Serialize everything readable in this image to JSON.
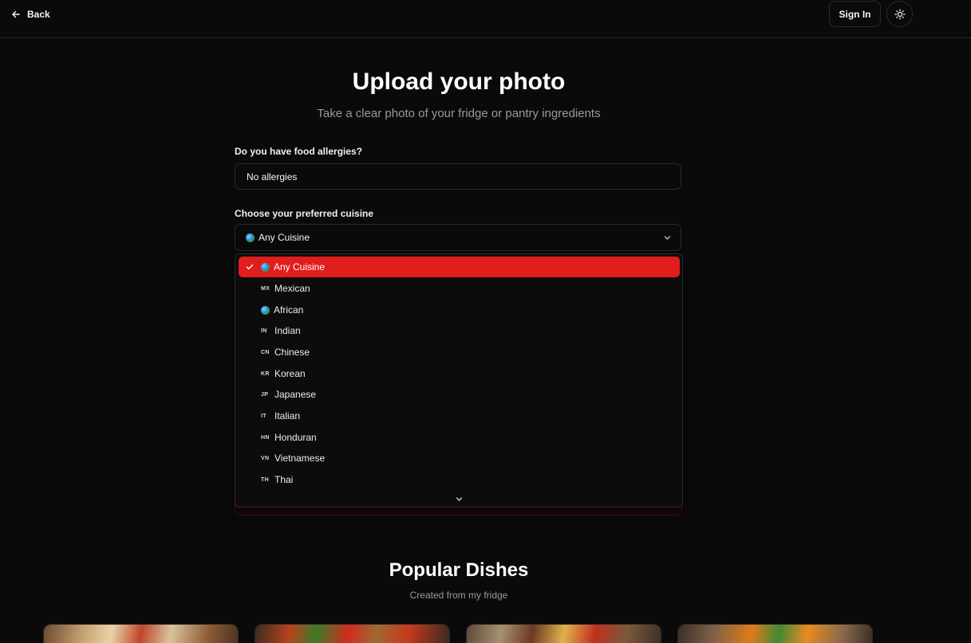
{
  "topbar": {
    "back_label": "Back",
    "signin_label": "Sign In"
  },
  "upload": {
    "title": "Upload your photo",
    "subtitle": "Take a clear photo of your fridge or pantry ingredients"
  },
  "allergies": {
    "label": "Do you have food allergies?",
    "value": "No allergies"
  },
  "cuisine": {
    "label": "Choose your preferred cuisine",
    "selected_label": "Any Cuisine",
    "options": [
      {
        "code": "",
        "icon": "globe-icon",
        "label": "Any Cuisine",
        "selected": true
      },
      {
        "code": "MX",
        "label": "Mexican"
      },
      {
        "code": "",
        "icon": "globe-icon",
        "label": "African"
      },
      {
        "code": "IN",
        "label": "Indian"
      },
      {
        "code": "CN",
        "label": "Chinese"
      },
      {
        "code": "KR",
        "label": "Korean"
      },
      {
        "code": "JP",
        "label": "Japanese"
      },
      {
        "code": "IT",
        "label": "Italian"
      },
      {
        "code": "HN",
        "label": "Honduran"
      },
      {
        "code": "VN",
        "label": "Vietnamese"
      },
      {
        "code": "TH",
        "label": "Thai"
      }
    ]
  },
  "popular": {
    "title": "Popular Dishes",
    "subtitle": "Created from my fridge"
  },
  "colors": {
    "accent": "#e11d1d",
    "background": "#0a0a0a",
    "muted_text": "#9a9a9a"
  }
}
